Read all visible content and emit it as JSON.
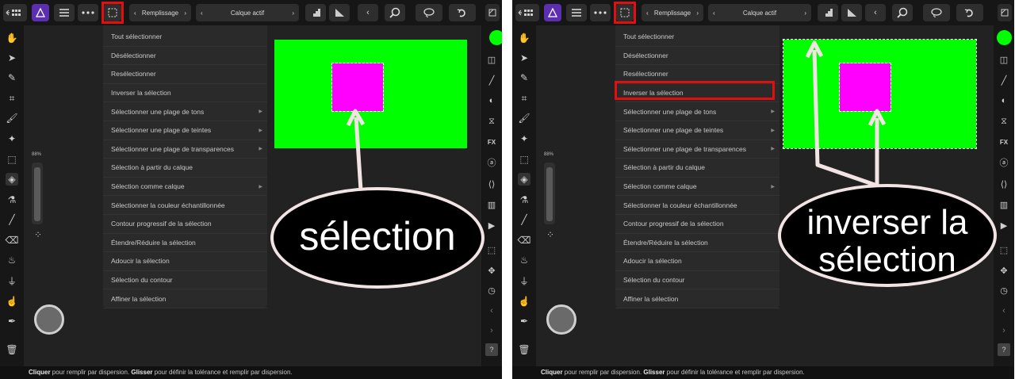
{
  "toolbar": {
    "fill_label": "Remplissage",
    "layer_label": "Calque actif"
  },
  "menu": {
    "items": [
      {
        "label": "Tout sélectionner",
        "submenu": false
      },
      {
        "label": "Désélectionner",
        "submenu": false
      },
      {
        "label": "Resélectionner",
        "submenu": false
      },
      {
        "label": "Inverser la sélection",
        "submenu": false
      },
      {
        "label": "Sélectionner une plage de tons",
        "submenu": true
      },
      {
        "label": "Sélectionner une plage de teintes",
        "submenu": true
      },
      {
        "label": "Sélectionner une plage de transparences",
        "submenu": true
      },
      {
        "label": "Sélection à partir du calque",
        "submenu": false
      },
      {
        "label": "Sélection comme calque",
        "submenu": true
      },
      {
        "label": "Sélectionner la couleur échantillonnée",
        "submenu": false
      },
      {
        "label": "Contour progressif de la sélection",
        "submenu": false
      },
      {
        "label": "Étendre/Réduire la sélection",
        "submenu": false
      },
      {
        "label": "Adoucir la sélection",
        "submenu": false
      },
      {
        "label": "Sélection du contour",
        "submenu": false
      },
      {
        "label": "Affiner la sélection",
        "submenu": false
      }
    ]
  },
  "zoom_label": "88%",
  "status": {
    "bold1": "Cliquer",
    "text1": " pour remplir par dispersion. ",
    "bold2": "Glisser",
    "text2": " pour définir la tolérance et remplir par dispersion."
  },
  "annotations": {
    "left": "sélection",
    "right_line1": "inverser la",
    "right_line2": "sélection"
  },
  "colors": {
    "highlight": "#e01010",
    "canvas_fill": "#00ff00",
    "selection_fill": "#ff00ff"
  }
}
